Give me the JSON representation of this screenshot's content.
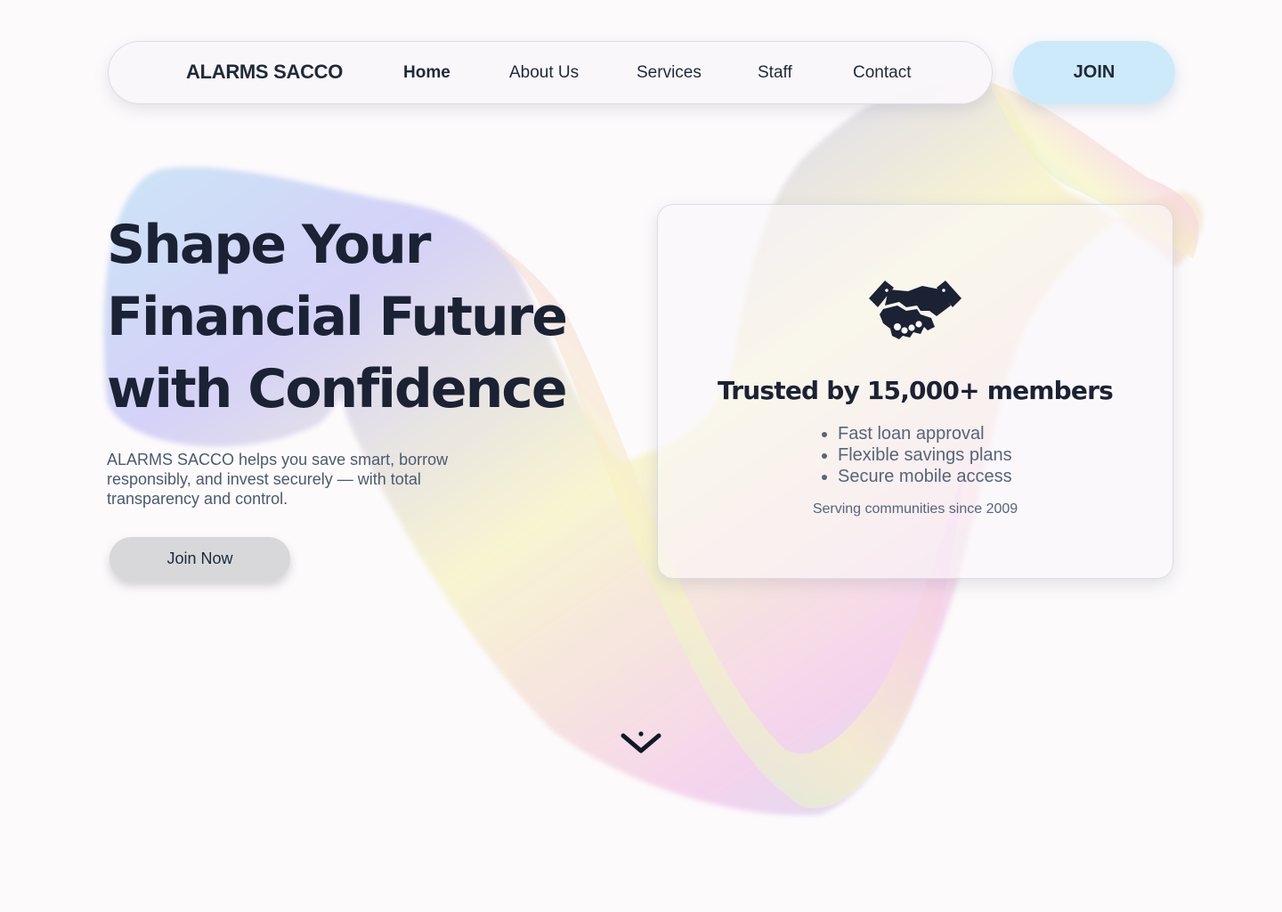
{
  "nav": {
    "brand": "ALARMS SACCO",
    "links": [
      {
        "label": "Home",
        "active": true
      },
      {
        "label": "About Us",
        "active": false
      },
      {
        "label": "Services",
        "active": false
      },
      {
        "label": "Staff",
        "active": false
      },
      {
        "label": "Contact",
        "active": false
      }
    ],
    "join_label": "JOIN"
  },
  "hero": {
    "title_lines": [
      "Shape Your",
      "Financial Future",
      "with Confidence"
    ],
    "description": "ALARMS SACCO helps you save smart, borrow responsibly, and invest securely — with total transparency and control.",
    "cta_label": "Join Now"
  },
  "card": {
    "icon": "handshake-icon",
    "title": "Trusted by 15,000+ members",
    "features": [
      "Fast loan approval",
      "Flexible savings plans",
      "Secure mobile access"
    ],
    "footnote": "Serving communities since 2009"
  },
  "scroll": {
    "icon": "chevron-down-icon"
  },
  "colors": {
    "background": "#fcfafb",
    "text_dark": "#1b2234",
    "text_muted": "#55657a",
    "join_pill": "#cdeafb",
    "cta_button": "#d8d8da"
  }
}
